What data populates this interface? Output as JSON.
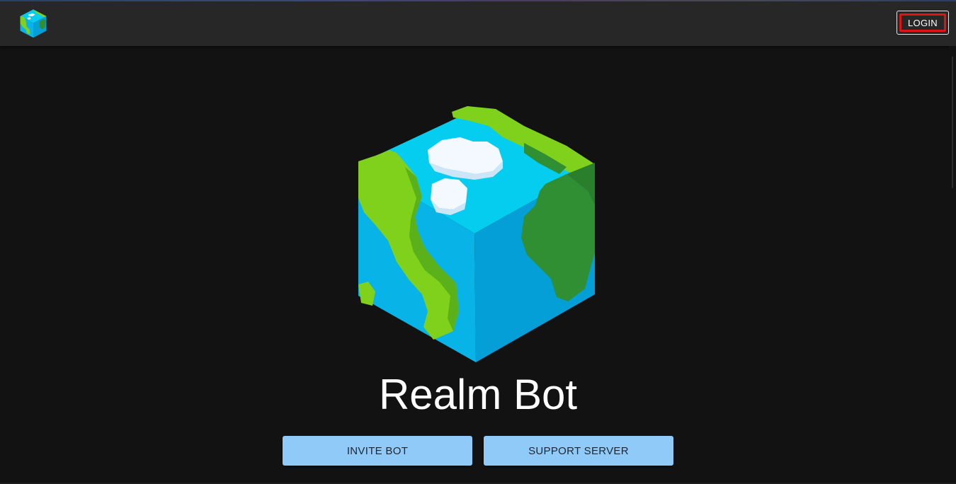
{
  "header": {
    "logo_icon": "earth-cube-icon",
    "login_label": "LOGIN"
  },
  "hero": {
    "logo_icon": "earth-cube-icon",
    "title": "Realm Bot"
  },
  "actions": {
    "invite_label": "INVITE BOT",
    "support_label": "SUPPORT SERVER"
  },
  "colors": {
    "background": "#121212",
    "appbar": "#272727",
    "button": "#90caf9",
    "login_highlight": "#e01414",
    "ocean_top": "#05cdf0",
    "ocean_left": "#08b3e8",
    "ocean_right": "#049fd6",
    "land_light": "#7fd11b",
    "land_dark": "#2f8f32"
  }
}
